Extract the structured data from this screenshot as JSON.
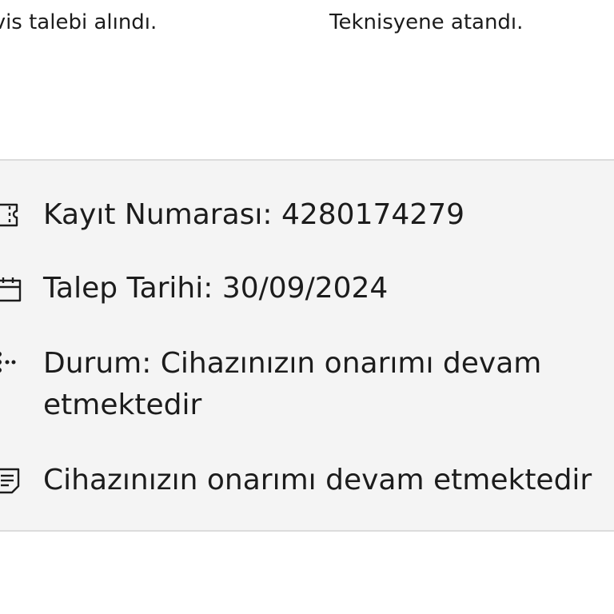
{
  "progress_steps": [
    {
      "label": "rvis talebi alındı."
    },
    {
      "label": "Teknisyene atandı."
    }
  ],
  "details": {
    "record_number": "Kayıt Numarası: 4280174279",
    "request_date": "Talep Tarihi: 30/09/2024",
    "status": "Durum: Cihazınızın onarımı devam etmektedir",
    "note": "Cihazınızın onarımı devam etmektedir"
  },
  "icons": {
    "record_number": "ticket-icon",
    "request_date": "calendar-icon",
    "status": "status-dots-icon",
    "note": "note-icon"
  }
}
